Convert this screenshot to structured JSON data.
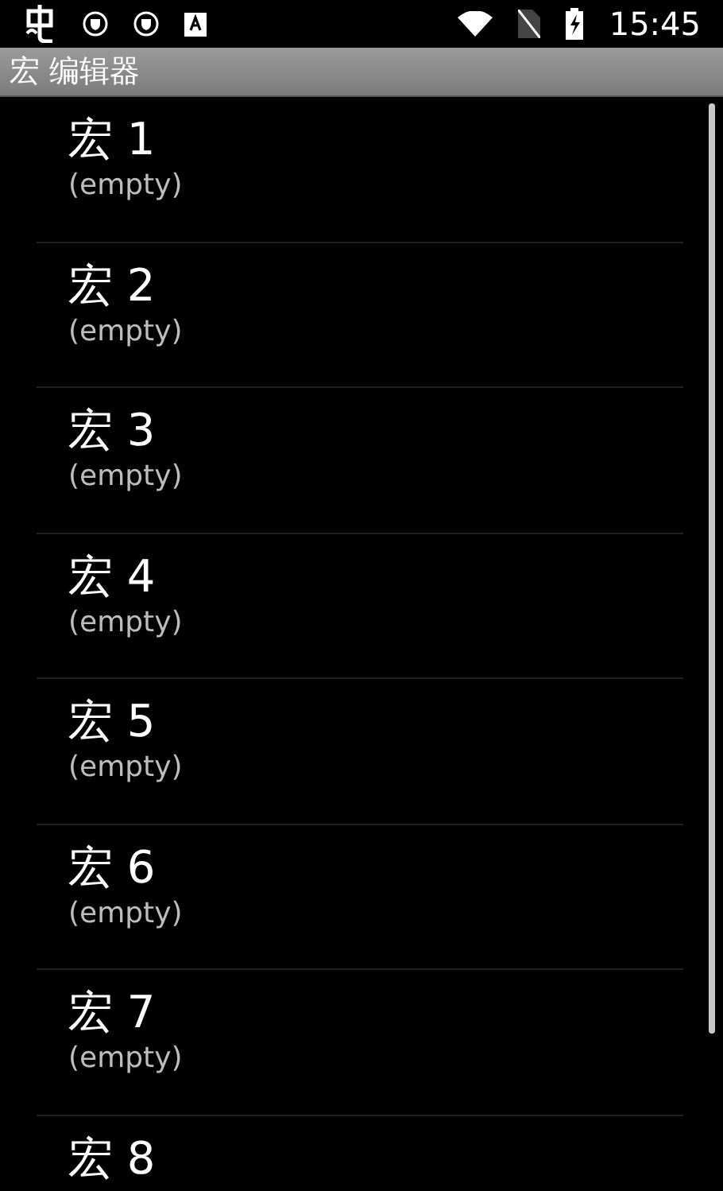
{
  "status_bar": {
    "time": "15:45"
  },
  "title_bar": {
    "title": "宏 编辑器"
  },
  "macros": [
    {
      "title": "宏 1",
      "subtitle": "(empty)"
    },
    {
      "title": "宏 2",
      "subtitle": "(empty)"
    },
    {
      "title": "宏 3",
      "subtitle": "(empty)"
    },
    {
      "title": "宏 4",
      "subtitle": "(empty)"
    },
    {
      "title": "宏 5",
      "subtitle": "(empty)"
    },
    {
      "title": "宏 6",
      "subtitle": "(empty)"
    },
    {
      "title": "宏 7",
      "subtitle": "(empty)"
    },
    {
      "title": "宏 8"
    }
  ]
}
